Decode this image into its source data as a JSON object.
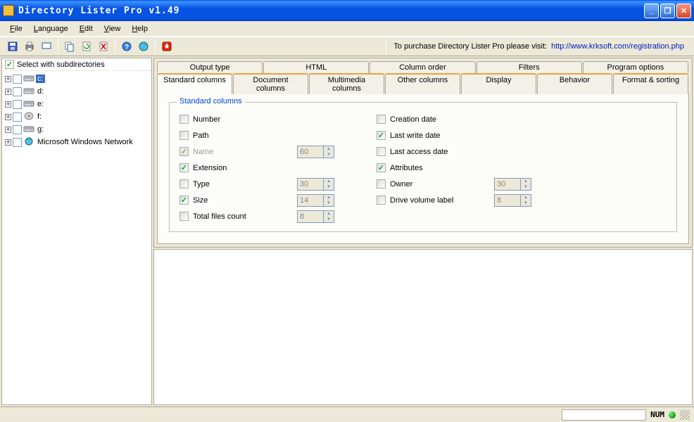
{
  "title": "Directory Lister Pro v1.49",
  "menus": {
    "file": "File",
    "language": "Language",
    "edit": "Edit",
    "view": "View",
    "help": "Help"
  },
  "toolbar_icons": [
    "save",
    "print",
    "preview",
    "copy",
    "refresh",
    "delete",
    "help",
    "globe",
    "stop"
  ],
  "purchase": {
    "text": "To purchase Directory Lister Pro please visit:",
    "url": "http://www.krksoft.com/registration.php"
  },
  "sidebar": {
    "header": "Select with subdirectories",
    "items": [
      {
        "label": "c:",
        "type": "hdd",
        "selected": true
      },
      {
        "label": "d:",
        "type": "hdd"
      },
      {
        "label": "e:",
        "type": "hdd"
      },
      {
        "label": "f:",
        "type": "cd"
      },
      {
        "label": "g:",
        "type": "hdd"
      },
      {
        "label": "Microsoft Windows Network",
        "type": "net"
      }
    ]
  },
  "tabs": {
    "row1": [
      "Output type",
      "HTML",
      "Column order",
      "Filters",
      "Program options"
    ],
    "row2": [
      "Standard columns",
      "Document columns",
      "Multimedia columns",
      "Other columns",
      "Display",
      "Behavior",
      "Format & sorting"
    ],
    "active": "Standard columns"
  },
  "fieldset_legend": "Standard columns",
  "fields": {
    "left": [
      {
        "key": "number",
        "label": "Number",
        "checked": false
      },
      {
        "key": "path",
        "label": "Path",
        "checked": false
      },
      {
        "key": "name",
        "label": "Name",
        "checked": true,
        "disabled": true,
        "spin": "60"
      },
      {
        "key": "extension",
        "label": "Extension",
        "checked": true
      },
      {
        "key": "type",
        "label": "Type",
        "checked": false,
        "spin": "30"
      },
      {
        "key": "size",
        "label": "Size",
        "checked": true,
        "spin": "14"
      },
      {
        "key": "total",
        "label": "Total files count",
        "checked": false,
        "spin": "8"
      }
    ],
    "right": [
      {
        "key": "creation",
        "label": "Creation date",
        "checked": false
      },
      {
        "key": "lastwrite",
        "label": "Last write date",
        "checked": true
      },
      {
        "key": "lastaccess",
        "label": "Last access date",
        "checked": false
      },
      {
        "key": "attributes",
        "label": "Attributes",
        "checked": true
      },
      {
        "key": "owner",
        "label": "Owner",
        "checked": false,
        "spin": "30"
      },
      {
        "key": "volume",
        "label": "Drive volume label",
        "checked": false,
        "spin": "8"
      }
    ]
  },
  "statusbar": {
    "num": "NUM"
  }
}
